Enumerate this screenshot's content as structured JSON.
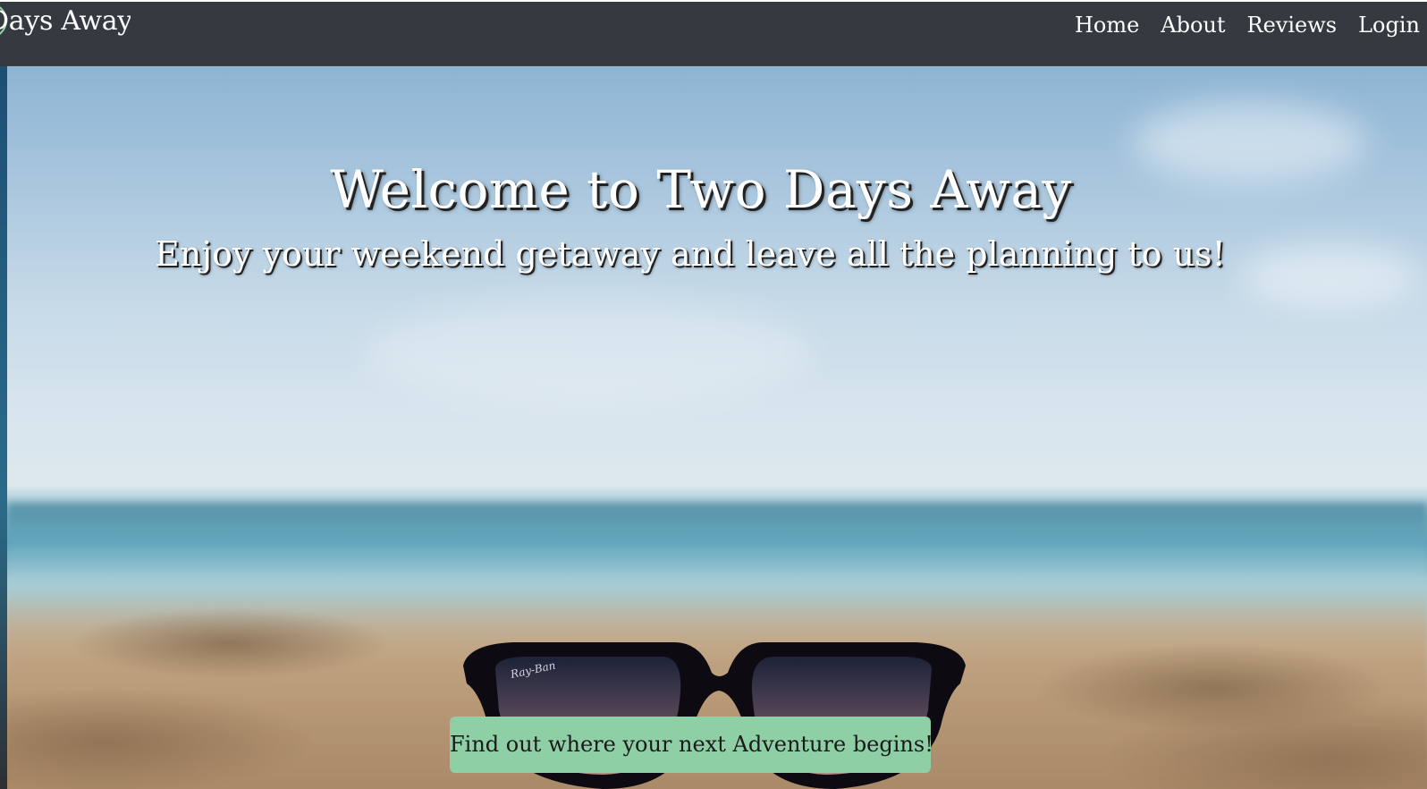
{
  "navbar": {
    "brand": "Days Away",
    "links": [
      {
        "label": "Home"
      },
      {
        "label": "About"
      },
      {
        "label": "Reviews"
      },
      {
        "label": "Login"
      }
    ]
  },
  "hero": {
    "title": "Welcome to Two Days Away",
    "subtitle": "Enjoy your weekend getaway and leave all the planning to us!",
    "cta_label": "Find out where your next Adventure begins!",
    "background_image": "beach-sunglasses-photo",
    "sunglasses_logo": "Ray-Ban"
  },
  "colors": {
    "navbar_bg": "#343a40",
    "cta_bg": "#8ecfa6",
    "text_light": "#ffffff"
  }
}
